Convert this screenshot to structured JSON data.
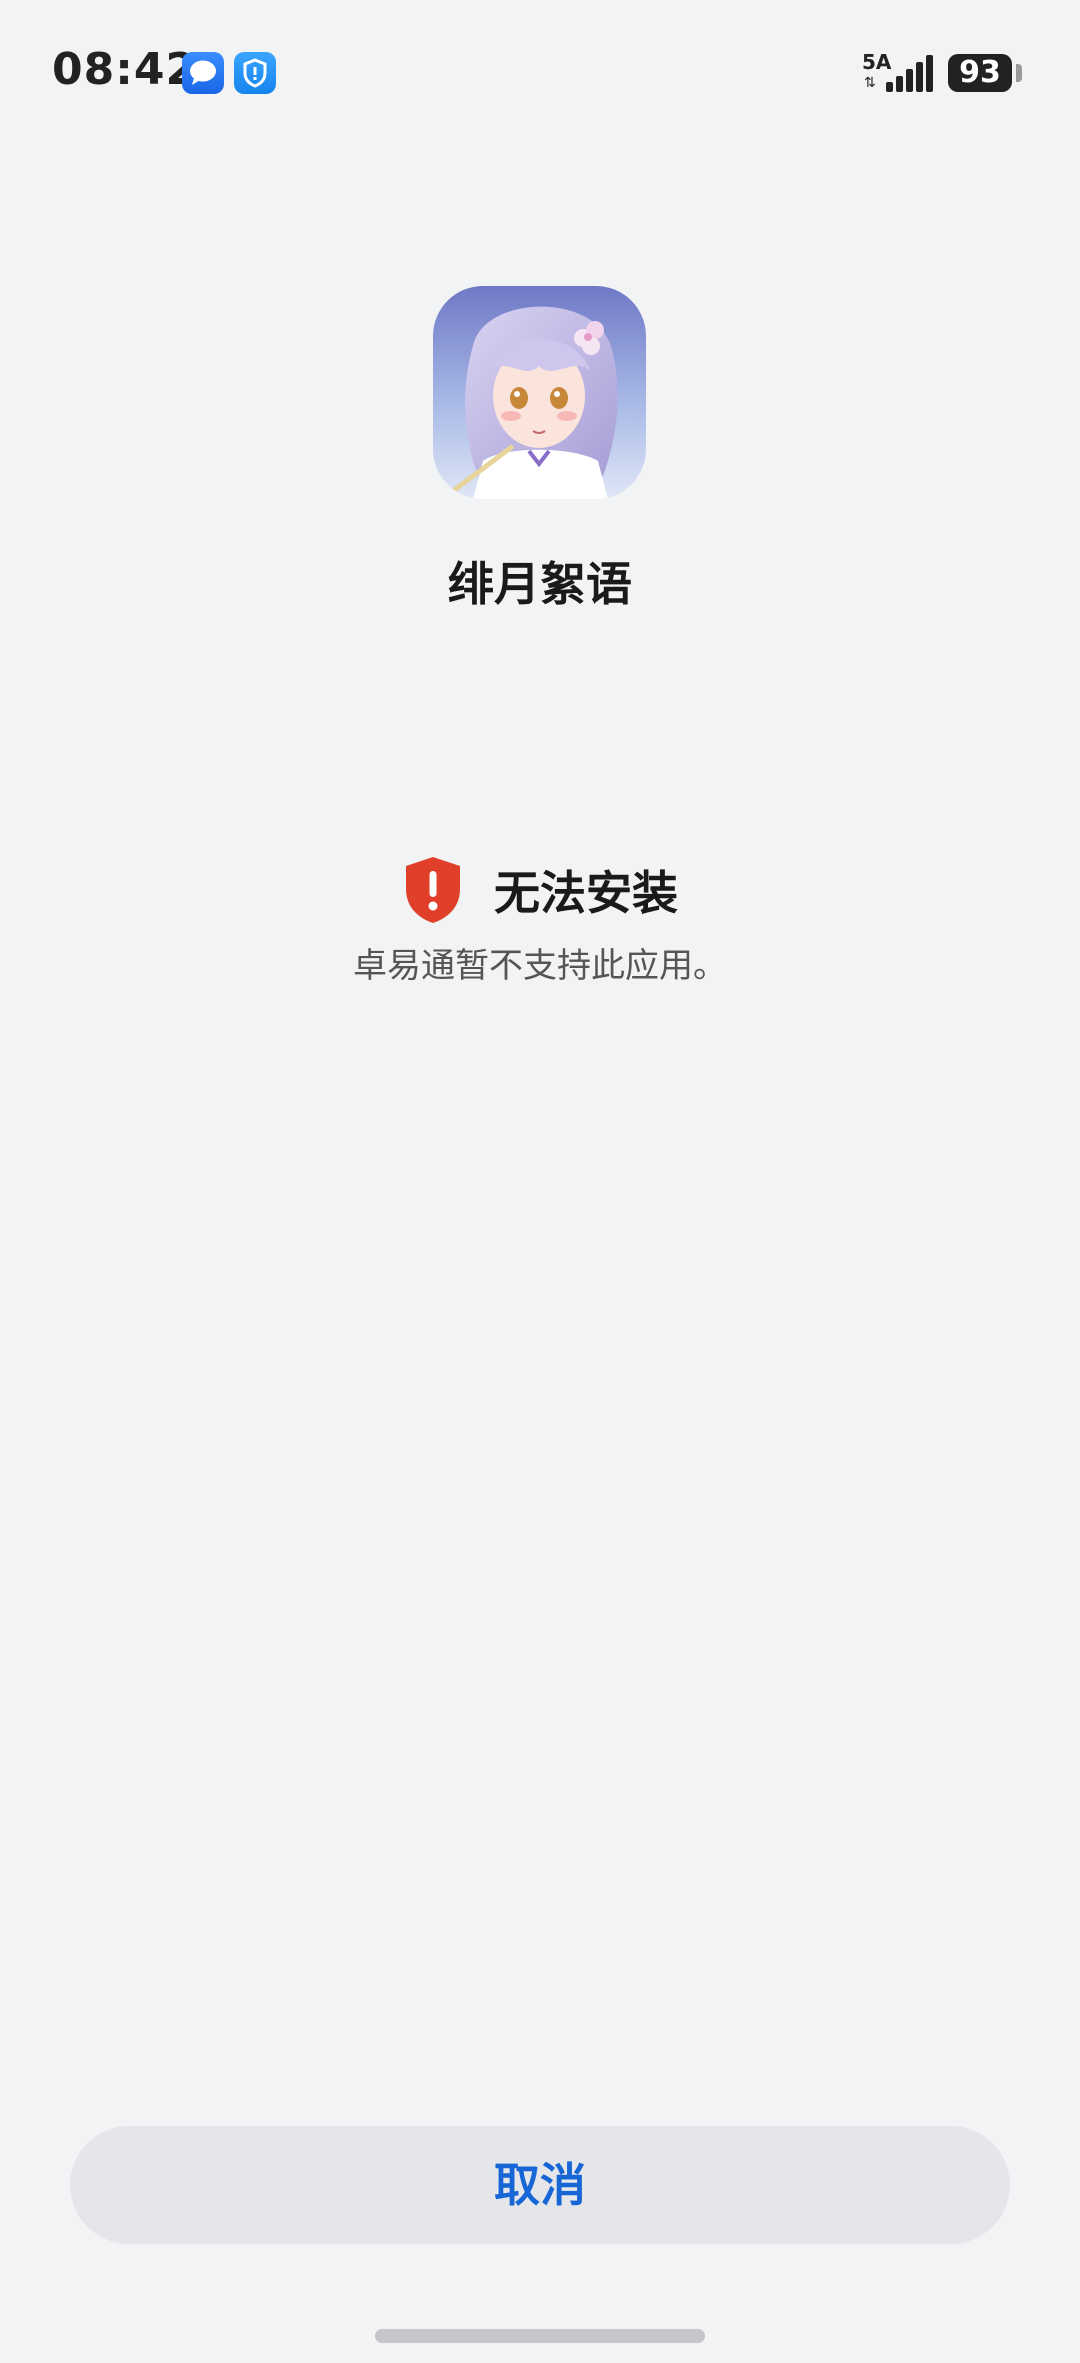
{
  "status_bar": {
    "time": "08:42",
    "network_type": "5A",
    "network_arrows": "⇅",
    "battery_level": "93",
    "notification_icons": [
      "message-icon",
      "shield-app-icon"
    ]
  },
  "app": {
    "name": "绯月絮语",
    "icon": "anime-character-app-icon"
  },
  "result": {
    "title": "无法安装",
    "description": "卓易通暂不支持此应用。",
    "icon": "shield-alert-icon"
  },
  "actions": {
    "cancel_label": "取消"
  },
  "colors": {
    "background": "#f2f3f5",
    "accent_blue": "#1766d6",
    "alert_red": "#e0402a",
    "button_bg": "#e5e6e9"
  }
}
